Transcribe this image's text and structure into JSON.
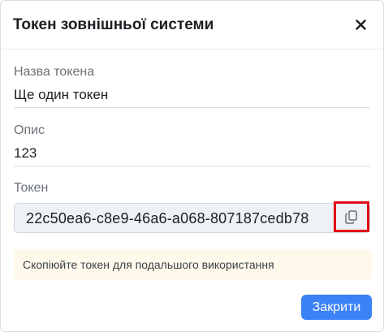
{
  "dialog": {
    "title": "Токен зовнішньої системи",
    "close_icon": "close-icon"
  },
  "fields": {
    "token_name": {
      "label": "Назва токена",
      "value": "Ще один токен"
    },
    "description": {
      "label": "Опис",
      "value": "123"
    },
    "token": {
      "label": "Токен",
      "value": "22c50ea6-c8e9-46a6-a068-807187cedb78",
      "copy_icon": "copy-icon"
    }
  },
  "hint": {
    "text": "Скопіюйте токен для подальшого використання"
  },
  "footer": {
    "close_label": "Закрити"
  },
  "colors": {
    "accent": "#3b82f6",
    "highlight": "#e30c17",
    "hint_bg": "#fef9ea",
    "token_bg": "#eef2f7"
  }
}
